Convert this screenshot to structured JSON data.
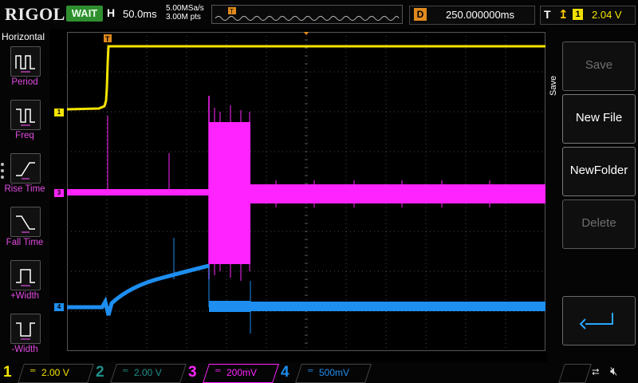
{
  "header": {
    "brand": "RIGOL",
    "run_state": "WAIT",
    "horizontal_label": "H",
    "timebase": "50.0ms",
    "sample_rate": "5.00MSa/s",
    "memory_depth": "3.00M pts",
    "delay_label": "D",
    "delay_value": "250.000000ms",
    "trigger_label": "T",
    "trigger_edge": "rising-edge",
    "trigger_channel": "1",
    "trigger_level": "2.04 V",
    "trigger_marker": "T"
  },
  "left_panel": {
    "title": "Horizontal",
    "items": [
      {
        "label": "Period",
        "icon": "period-icon"
      },
      {
        "label": "Freq",
        "icon": "frequency-icon"
      },
      {
        "label": "Rise Time",
        "icon": "rise-time-icon"
      },
      {
        "label": "Fall Time",
        "icon": "fall-time-icon"
      },
      {
        "label": "+Width",
        "icon": "positive-width-icon"
      },
      {
        "label": "-Width",
        "icon": "negative-width-icon"
      }
    ]
  },
  "right_panel": {
    "title": "Save",
    "buttons": [
      {
        "label": "Save",
        "enabled": false
      },
      {
        "label": "New File",
        "enabled": true
      },
      {
        "label": "NewFolder",
        "enabled": true
      },
      {
        "label": "Delete",
        "enabled": false
      }
    ],
    "back_icon": "return-arrow-icon"
  },
  "channels": [
    {
      "number": "1",
      "scale": "2.00 V",
      "color": "#f5e400",
      "active": true,
      "marker": "1"
    },
    {
      "number": "2",
      "scale": "2.00 V",
      "color": "#1f8f8a",
      "active": false,
      "marker": "2"
    },
    {
      "number": "3",
      "scale": "200mV",
      "color": "#ff24ff",
      "active": true,
      "marker": "3"
    },
    {
      "number": "4",
      "scale": "500mV",
      "color": "#1e8ef0",
      "active": true,
      "marker": "4"
    }
  ],
  "status_icons": [
    "usb-icon",
    "mute-icon"
  ],
  "colors": {
    "ch1": "#f5e400",
    "ch3": "#ff24ff",
    "ch4": "#1e8ef0",
    "trigger": "#e08a1e",
    "run_state_bg": "#2f8f2f"
  }
}
